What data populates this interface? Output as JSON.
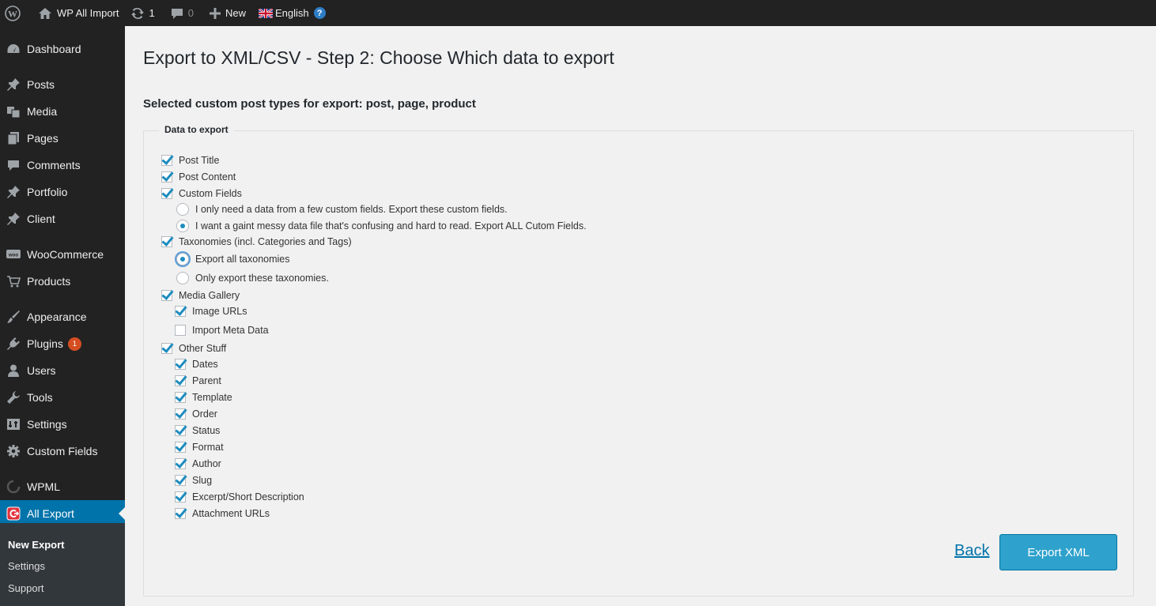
{
  "admin_bar": {
    "site_name": "WP All Import",
    "updates_count": "1",
    "comments_count": "0",
    "new_label": "New",
    "language_label": "English",
    "help_glyph": "?",
    "icons": [
      "wordpress-logo-icon",
      "home-icon",
      "updates-icon",
      "comments-icon",
      "plus-icon",
      "uk-flag-icon",
      "help-icon"
    ]
  },
  "sidebar": {
    "items": [
      {
        "label": "Dashboard",
        "icon": "dashboard-icon"
      },
      {
        "label": "Posts",
        "icon": "pin-icon"
      },
      {
        "label": "Media",
        "icon": "media-icon"
      },
      {
        "label": "Pages",
        "icon": "pages-icon"
      },
      {
        "label": "Comments",
        "icon": "comment-icon"
      },
      {
        "label": "Portfolio",
        "icon": "pin-icon"
      },
      {
        "label": "Client",
        "icon": "pin-icon"
      },
      {
        "label": "WooCommerce",
        "icon": "woocommerce-icon"
      },
      {
        "label": "Products",
        "icon": "cart-icon"
      },
      {
        "label": "Appearance",
        "icon": "brush-icon"
      },
      {
        "label": "Plugins",
        "icon": "plug-icon",
        "badge": "1"
      },
      {
        "label": "Users",
        "icon": "user-icon"
      },
      {
        "label": "Tools",
        "icon": "wrench-icon"
      },
      {
        "label": "Settings",
        "icon": "settings-icon"
      },
      {
        "label": "Custom Fields",
        "icon": "gear-icon"
      },
      {
        "label": "WPML",
        "icon": "wpml-icon"
      },
      {
        "label": "All Export",
        "icon": "all-export-icon",
        "current": true
      }
    ],
    "submenu": [
      {
        "label": "New Export",
        "current": true
      },
      {
        "label": "Settings"
      },
      {
        "label": "Support"
      }
    ]
  },
  "page": {
    "title": "Export to XML/CSV - Step 2: Choose Which data to export",
    "selected_types": "Selected custom post types for export: post, page, product",
    "legend": "Data to export",
    "options": {
      "post_title": {
        "label": "Post Title",
        "checked": true
      },
      "post_content": {
        "label": "Post Content",
        "checked": true
      },
      "custom_fields": {
        "label": "Custom Fields",
        "checked": true
      },
      "custom_fields_few": {
        "label": "I only need a data from a few custom fields. Export these custom fields.",
        "checked": false
      },
      "custom_fields_all": {
        "label": "I want a gaint messy data file that's confusing and hard to read. Export ALL Cutom Fields.",
        "checked": true
      },
      "taxonomies": {
        "label": "Taxonomies (incl. Categories and Tags)",
        "checked": true
      },
      "tax_all": {
        "label": "Export all taxonomies",
        "checked": true
      },
      "tax_some": {
        "label": "Only export these taxonomies.",
        "checked": false
      },
      "media_gallery": {
        "label": "Media Gallery",
        "checked": true
      },
      "image_urls": {
        "label": "Image URLs",
        "checked": true
      },
      "import_meta": {
        "label": "Import Meta Data",
        "checked": false
      },
      "other_stuff": {
        "label": "Other Stuff",
        "checked": true
      },
      "dates": {
        "label": "Dates",
        "checked": true
      },
      "parent": {
        "label": "Parent",
        "checked": true
      },
      "template": {
        "label": "Template",
        "checked": true
      },
      "order": {
        "label": "Order",
        "checked": true
      },
      "status": {
        "label": "Status",
        "checked": true
      },
      "format": {
        "label": "Format",
        "checked": true
      },
      "author": {
        "label": "Author",
        "checked": true
      },
      "slug": {
        "label": "Slug",
        "checked": true
      },
      "excerpt": {
        "label": "Excerpt/Short Description",
        "checked": true
      },
      "attachment_urls": {
        "label": "Attachment URLs",
        "checked": true
      }
    },
    "back_label": "Back",
    "export_label": "Export XML"
  },
  "colors": {
    "admin_bg": "#222222",
    "accent": "#0073aa",
    "button": "#2ea2cc",
    "checkmark": "#1e8cbe",
    "badge": "#d54e21"
  }
}
